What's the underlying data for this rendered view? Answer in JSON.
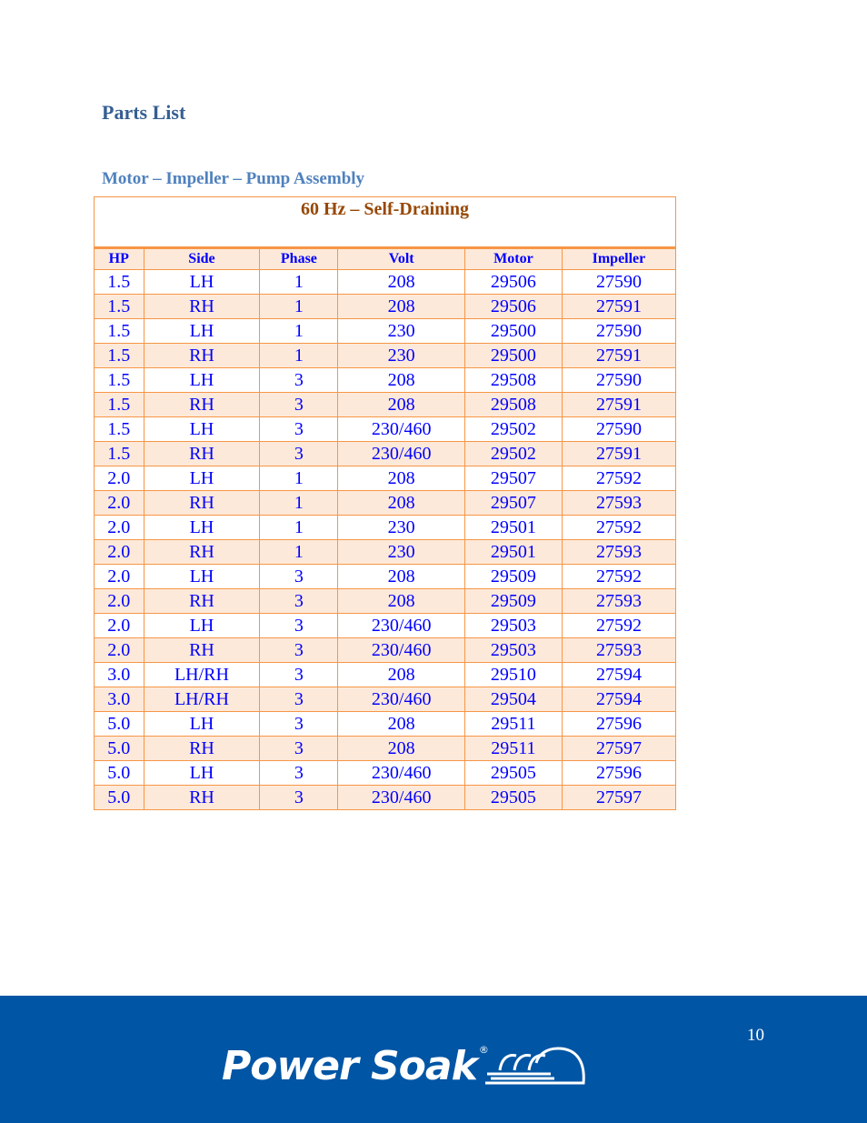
{
  "document": {
    "title": "Parts List",
    "section": "Motor – Impeller – Pump Assembly"
  },
  "table": {
    "caption": "60 Hz – Self-Draining",
    "columns": [
      "HP",
      "Side",
      "Phase",
      "Volt",
      "Motor",
      "Impeller"
    ],
    "rows": [
      [
        "1.5",
        "LH",
        "1",
        "208",
        "29506",
        "27590"
      ],
      [
        "1.5",
        "RH",
        "1",
        "208",
        "29506",
        "27591"
      ],
      [
        "1.5",
        "LH",
        "1",
        "230",
        "29500",
        "27590"
      ],
      [
        "1.5",
        "RH",
        "1",
        "230",
        "29500",
        "27591"
      ],
      [
        "1.5",
        "LH",
        "3",
        "208",
        "29508",
        "27590"
      ],
      [
        "1.5",
        "RH",
        "3",
        "208",
        "29508",
        "27591"
      ],
      [
        "1.5",
        "LH",
        "3",
        "230/460",
        "29502",
        "27590"
      ],
      [
        "1.5",
        "RH",
        "3",
        "230/460",
        "29502",
        "27591"
      ],
      [
        "2.0",
        "LH",
        "1",
        "208",
        "29507",
        "27592"
      ],
      [
        "2.0",
        "RH",
        "1",
        "208",
        "29507",
        "27593"
      ],
      [
        "2.0",
        "LH",
        "1",
        "230",
        "29501",
        "27592"
      ],
      [
        "2.0",
        "RH",
        "1",
        "230",
        "29501",
        "27593"
      ],
      [
        "2.0",
        "LH",
        "3",
        "208",
        "29509",
        "27592"
      ],
      [
        "2.0",
        "RH",
        "3",
        "208",
        "29509",
        "27593"
      ],
      [
        "2.0",
        "LH",
        "3",
        "230/460",
        "29503",
        "27592"
      ],
      [
        "2.0",
        "RH",
        "3",
        "230/460",
        "29503",
        "27593"
      ],
      [
        "3.0",
        "LH/RH",
        "3",
        "208",
        "29510",
        "27594"
      ],
      [
        "3.0",
        "LH/RH",
        "3",
        "230/460",
        "29504",
        "27594"
      ],
      [
        "5.0",
        "LH",
        "3",
        "208",
        "29511",
        "27596"
      ],
      [
        "5.0",
        "RH",
        "3",
        "208",
        "29511",
        "27597"
      ],
      [
        "5.0",
        "LH",
        "3",
        "230/460",
        "29505",
        "27596"
      ],
      [
        "5.0",
        "RH",
        "3",
        "230/460",
        "29505",
        "27597"
      ]
    ]
  },
  "footer": {
    "logo_text": "Power Soak",
    "registered_mark": "®",
    "page_number": "10",
    "background_color": "#0055a5"
  },
  "colors": {
    "heading": "#365f91",
    "subheading": "#4f81bd",
    "table_border": "#f79646",
    "table_band": "#fde9d9",
    "caption": "#974806",
    "cell_text": "#0000ff"
  }
}
